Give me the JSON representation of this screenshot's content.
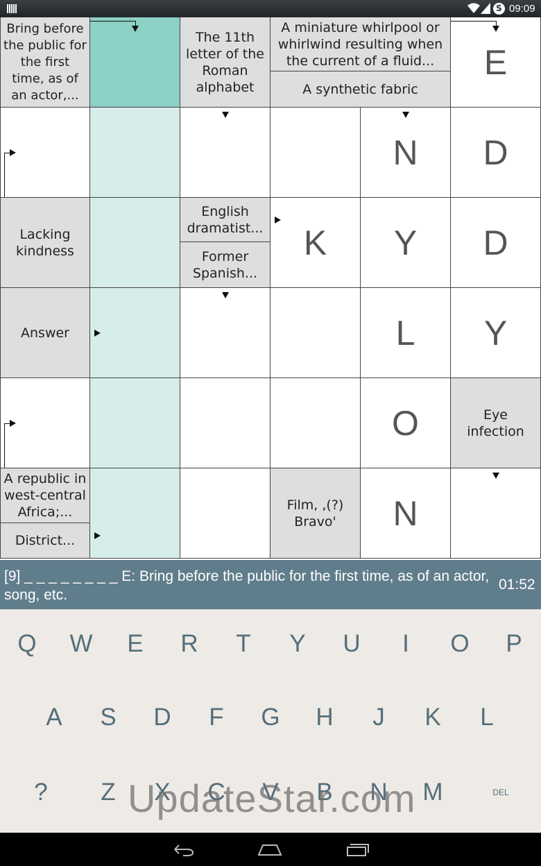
{
  "status": {
    "time": "09:09",
    "sync_glyph": "S"
  },
  "grid": {
    "letters": {
      "e_top": "E",
      "n1": "N",
      "d1": "D",
      "k": "K",
      "y1": "Y",
      "d2": "D",
      "l": "L",
      "y2": "Y",
      "o": "O",
      "n2": "N"
    },
    "clues": {
      "bring_before": "Bring before the public for the first time, as of an actor,...",
      "eleventh_letter": "The 11th letter of the Roman alphabet",
      "whirlpool": "A miniature whirlpool or whirlwind resulting when the current of a fluid...",
      "synthetic": "A synthetic fabric",
      "lacking": "Lacking kindness",
      "english": "English dramatist...",
      "former": "Former Spanish...",
      "answer": "Answer",
      "eye": "Eye infection",
      "republic": "A republic in west-central Africa;...",
      "district": "District...",
      "film": "Film, ,(?) Bravo'"
    }
  },
  "clue_bar": {
    "text": "[9] _ _ _ _ _ _ _ _ E: Bring before the public for the first time, as of an actor, song, etc.",
    "timer": "01:52"
  },
  "keyboard": {
    "row1": [
      "Q",
      "W",
      "E",
      "R",
      "T",
      "Y",
      "U",
      "I",
      "O",
      "P"
    ],
    "row2": [
      "A",
      "S",
      "D",
      "F",
      "G",
      "H",
      "J",
      "K",
      "L"
    ],
    "row3": [
      "?",
      "Z",
      "X",
      "C",
      "V",
      "B",
      "N",
      "M",
      "DEL"
    ]
  },
  "watermark": "UpdateStar.com",
  "colors": {
    "accent": "#8dd0c5",
    "highlight": "#d6ede9",
    "clue_bar": "#607d8b",
    "keyboard_bg": "#eeeae6",
    "clue_bg": "#dedede"
  }
}
